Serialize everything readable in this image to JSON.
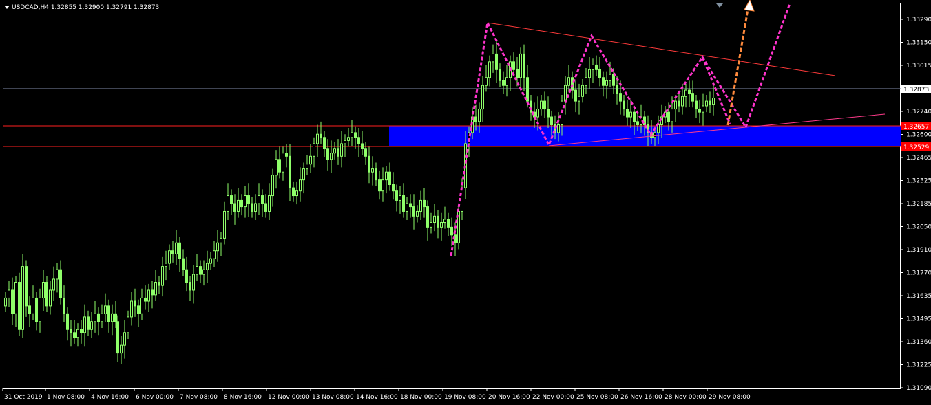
{
  "header": {
    "title": "USDCAD,H4  1.32855 1.32900 1.32791 1.32873"
  },
  "colors": {
    "background": "#000000",
    "candle": "#8fff6a",
    "grid_frame": "#ffffff",
    "zone_fill": "#0000ff",
    "resistance_line": "#ff0000",
    "pattern": "#ff33cc",
    "projection": "#ff8a3d",
    "current_price_line": "#8090b0"
  },
  "chart_data": {
    "type": "candlestick",
    "symbol": "USDCAD",
    "timeframe": "H4",
    "title": "USDCAD,H4  1.32855 1.32900 1.32791 1.32873",
    "ylim": [
      1.3103,
      1.3337
    ],
    "y_ticks": [
      "1.33290",
      "1.33150",
      "1.33015",
      "1.32873",
      "1.32740",
      "1.32600",
      "1.32465",
      "1.32325",
      "1.32185",
      "1.32050",
      "1.31910",
      "1.31770",
      "1.31635",
      "1.31495",
      "1.31360",
      "1.31225",
      "1.31090"
    ],
    "x_ticks": [
      "31 Oct 2019",
      "1 Nov 08:00",
      "4 Nov 16:00",
      "6 Nov 00:00",
      "7 Nov 08:00",
      "8 Nov 16:00",
      "12 Nov 00:00",
      "13 Nov 08:00",
      "14 Nov 16:00",
      "18 Nov 00:00",
      "19 Nov 08:00",
      "20 Nov 16:00",
      "22 Nov 00:00",
      "25 Nov 08:00",
      "26 Nov 16:00",
      "28 Nov 00:00",
      "29 Nov 08:00"
    ],
    "current_price": "1.32873",
    "level_labels": [
      "1.32657",
      "1.32529"
    ],
    "levels": [
      1.32657,
      1.32529
    ],
    "close_path": [
      [
        0,
        1.316
      ],
      [
        5,
        1.3165
      ],
      [
        10,
        1.315
      ],
      [
        15,
        1.317
      ],
      [
        20,
        1.314
      ],
      [
        25,
        1.318
      ],
      [
        30,
        1.3155
      ],
      [
        35,
        1.315
      ],
      [
        40,
        1.316
      ],
      [
        45,
        1.3145
      ],
      [
        50,
        1.316
      ],
      [
        55,
        1.317
      ],
      [
        60,
        1.3155
      ],
      [
        65,
        1.3165
      ],
      [
        70,
        1.3172
      ],
      [
        75,
        1.3178
      ],
      [
        80,
        1.316
      ],
      [
        85,
        1.315
      ],
      [
        90,
        1.314
      ],
      [
        95,
        1.3138
      ],
      [
        100,
        1.3135
      ],
      [
        105,
        1.314
      ],
      [
        110,
        1.3138
      ],
      [
        115,
        1.3148
      ],
      [
        120,
        1.314
      ],
      [
        125,
        1.3145
      ],
      [
        130,
        1.315
      ],
      [
        135,
        1.3145
      ],
      [
        140,
        1.315
      ],
      [
        145,
        1.3155
      ],
      [
        150,
        1.3145
      ],
      [
        155,
        1.315
      ],
      [
        160,
        1.3145
      ],
      [
        163,
        1.3125
      ],
      [
        168,
        1.313
      ],
      [
        173,
        1.3138
      ],
      [
        178,
        1.3148
      ],
      [
        183,
        1.3158
      ],
      [
        188,
        1.3155
      ],
      [
        193,
        1.315
      ],
      [
        198,
        1.316
      ],
      [
        203,
        1.3158
      ],
      [
        208,
        1.3165
      ],
      [
        213,
        1.3162
      ],
      [
        218,
        1.317
      ],
      [
        223,
        1.3168
      ],
      [
        228,
        1.318
      ],
      [
        233,
        1.3182
      ],
      [
        238,
        1.319
      ],
      [
        243,
        1.3188
      ],
      [
        248,
        1.3195
      ],
      [
        253,
        1.3185
      ],
      [
        258,
        1.3178
      ],
      [
        263,
        1.317
      ],
      [
        268,
        1.3165
      ],
      [
        273,
        1.3175
      ],
      [
        278,
        1.318
      ],
      [
        283,
        1.3175
      ],
      [
        288,
        1.3178
      ],
      [
        293,
        1.3182
      ],
      [
        298,
        1.3185
      ],
      [
        303,
        1.319
      ],
      [
        308,
        1.3195
      ],
      [
        313,
        1.3198
      ],
      [
        318,
        1.3215
      ],
      [
        323,
        1.3225
      ],
      [
        328,
        1.322
      ],
      [
        333,
        1.3215
      ],
      [
        338,
        1.3222
      ],
      [
        343,
        1.3218
      ],
      [
        348,
        1.3225
      ],
      [
        353,
        1.322
      ],
      [
        358,
        1.3215
      ],
      [
        363,
        1.322
      ],
      [
        368,
        1.3225
      ],
      [
        373,
        1.322
      ],
      [
        378,
        1.3215
      ],
      [
        383,
        1.3225
      ],
      [
        388,
        1.3238
      ],
      [
        393,
        1.3248
      ],
      [
        398,
        1.324
      ],
      [
        403,
        1.3252
      ],
      [
        408,
        1.325
      ],
      [
        413,
        1.323
      ],
      [
        418,
        1.3225
      ],
      [
        423,
        1.3228
      ],
      [
        428,
        1.3235
      ],
      [
        433,
        1.3242
      ],
      [
        438,
        1.3245
      ],
      [
        443,
        1.325
      ],
      [
        448,
        1.3258
      ],
      [
        453,
        1.3264
      ],
      [
        458,
        1.3262
      ],
      [
        463,
        1.3255
      ],
      [
        468,
        1.3248
      ],
      [
        473,
        1.3252
      ],
      [
        478,
        1.3255
      ],
      [
        483,
        1.325
      ],
      [
        488,
        1.3258
      ],
      [
        493,
        1.326
      ],
      [
        498,
        1.3262
      ],
      [
        503,
        1.3265
      ],
      [
        508,
        1.3262
      ],
      [
        513,
        1.3258
      ],
      [
        518,
        1.3255
      ],
      [
        523,
        1.325
      ],
      [
        528,
        1.324
      ],
      [
        533,
        1.3242
      ],
      [
        538,
        1.3235
      ],
      [
        543,
        1.3228
      ],
      [
        548,
        1.3235
      ],
      [
        553,
        1.324
      ],
      [
        558,
        1.3232
      ],
      [
        563,
        1.3228
      ],
      [
        568,
        1.3222
      ],
      [
        573,
        1.3225
      ],
      [
        578,
        1.3215
      ],
      [
        583,
        1.322
      ],
      [
        588,
        1.3218
      ],
      [
        593,
        1.3212
      ],
      [
        598,
        1.3215
      ],
      [
        603,
        1.3222
      ],
      [
        608,
        1.3218
      ],
      [
        613,
        1.3205
      ],
      [
        618,
        1.3208
      ],
      [
        623,
        1.3212
      ],
      [
        628,
        1.3205
      ],
      [
        633,
        1.3208
      ],
      [
        638,
        1.321
      ],
      [
        643,
        1.3205
      ],
      [
        648,
        1.32
      ],
      [
        653,
        1.3195
      ],
      [
        658,
        1.3215
      ],
      [
        663,
        1.323
      ],
      [
        668,
        1.3258
      ],
      [
        673,
        1.3265
      ],
      [
        678,
        1.3275
      ],
      [
        683,
        1.3272
      ],
      [
        688,
        1.328
      ],
      [
        693,
        1.3295
      ],
      [
        698,
        1.33
      ],
      [
        703,
        1.331
      ],
      [
        708,
        1.3315
      ],
      [
        713,
        1.3305
      ],
      [
        718,
        1.3298
      ],
      [
        723,
        1.3295
      ],
      [
        728,
        1.33
      ],
      [
        733,
        1.331
      ],
      [
        738,
        1.3305
      ],
      [
        743,
        1.33
      ],
      [
        748,
        1.3315
      ],
      [
        753,
        1.33
      ],
      [
        758,
        1.3285
      ],
      [
        763,
        1.3278
      ],
      [
        768,
        1.3275
      ],
      [
        773,
        1.328
      ],
      [
        778,
        1.3285
      ],
      [
        783,
        1.328
      ],
      [
        788,
        1.3275
      ],
      [
        793,
        1.327
      ],
      [
        798,
        1.3265
      ],
      [
        803,
        1.327
      ],
      [
        808,
        1.3285
      ],
      [
        813,
        1.3295
      ],
      [
        818,
        1.33
      ],
      [
        823,
        1.3292
      ],
      [
        828,
        1.3285
      ],
      [
        833,
        1.3288
      ],
      [
        838,
        1.3295
      ],
      [
        843,
        1.33
      ],
      [
        848,
        1.3305
      ],
      [
        853,
        1.3308
      ],
      [
        858,
        1.3305
      ],
      [
        863,
        1.33
      ],
      [
        868,
        1.3295
      ],
      [
        873,
        1.3298
      ],
      [
        878,
        1.3302
      ],
      [
        883,
        1.3295
      ],
      [
        888,
        1.329
      ],
      [
        893,
        1.3285
      ],
      [
        898,
        1.328
      ],
      [
        903,
        1.3275
      ],
      [
        908,
        1.3278
      ],
      [
        913,
        1.3272
      ],
      [
        918,
        1.327
      ],
      [
        923,
        1.3275
      ],
      [
        928,
        1.327
      ],
      [
        933,
        1.3265
      ],
      [
        938,
        1.3262
      ],
      [
        943,
        1.3265
      ],
      [
        948,
        1.327
      ],
      [
        953,
        1.3275
      ],
      [
        958,
        1.3278
      ],
      [
        963,
        1.3272
      ],
      [
        968,
        1.328
      ],
      [
        973,
        1.3285
      ],
      [
        978,
        1.3282
      ],
      [
        983,
        1.3288
      ],
      [
        988,
        1.3292
      ],
      [
        993,
        1.329
      ],
      [
        998,
        1.3285
      ],
      [
        1003,
        1.328
      ],
      [
        1008,
        1.3278
      ],
      [
        1013,
        1.3282
      ],
      [
        1018,
        1.3285
      ],
      [
        1023,
        1.3283
      ],
      [
        1028,
        1.3287
      ]
    ],
    "projection_note": "",
    "grid": false
  }
}
